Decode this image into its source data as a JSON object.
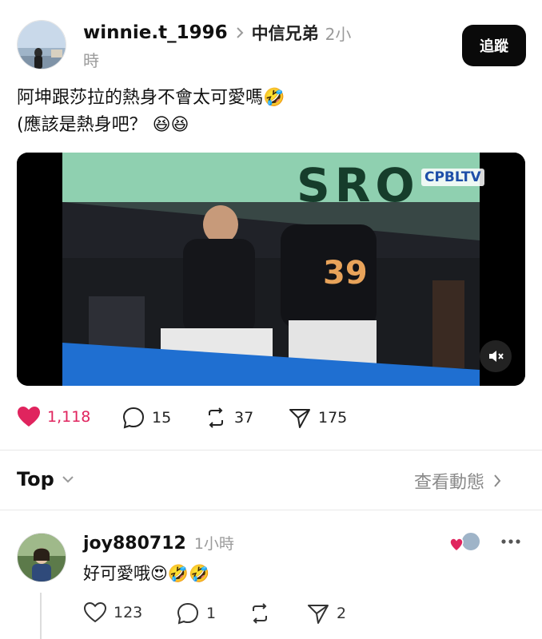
{
  "post": {
    "author": "winnie.t_1996",
    "separator_icon": "chevron-right",
    "community": "中信兄弟",
    "time_part1": "2小",
    "time_part2": "時",
    "follow_label": "追蹤",
    "text_line1": "阿坤跟莎拉的熱身不會太可愛嗎",
    "text_line1_emoji": "🤣",
    "text_line2": "(應該是熱身吧？",
    "text_line2_emoji": "😆😆",
    "video_watermark": "CPBLTV",
    "video_banner_text": "SRO",
    "stats": {
      "likes": "1,118",
      "comments": "15",
      "reposts": "37",
      "shares": "175"
    },
    "liked": true,
    "accent_color": "#e0245e"
  },
  "replies_header": {
    "sort_label": "Top",
    "activity_link": "查看動態"
  },
  "comment": {
    "author": "joy880712",
    "time": "1小時",
    "text": "好可愛哦",
    "emoji": "😍🤣🤣",
    "stats": {
      "likes": "123",
      "comments": "1",
      "shares": "2"
    }
  }
}
